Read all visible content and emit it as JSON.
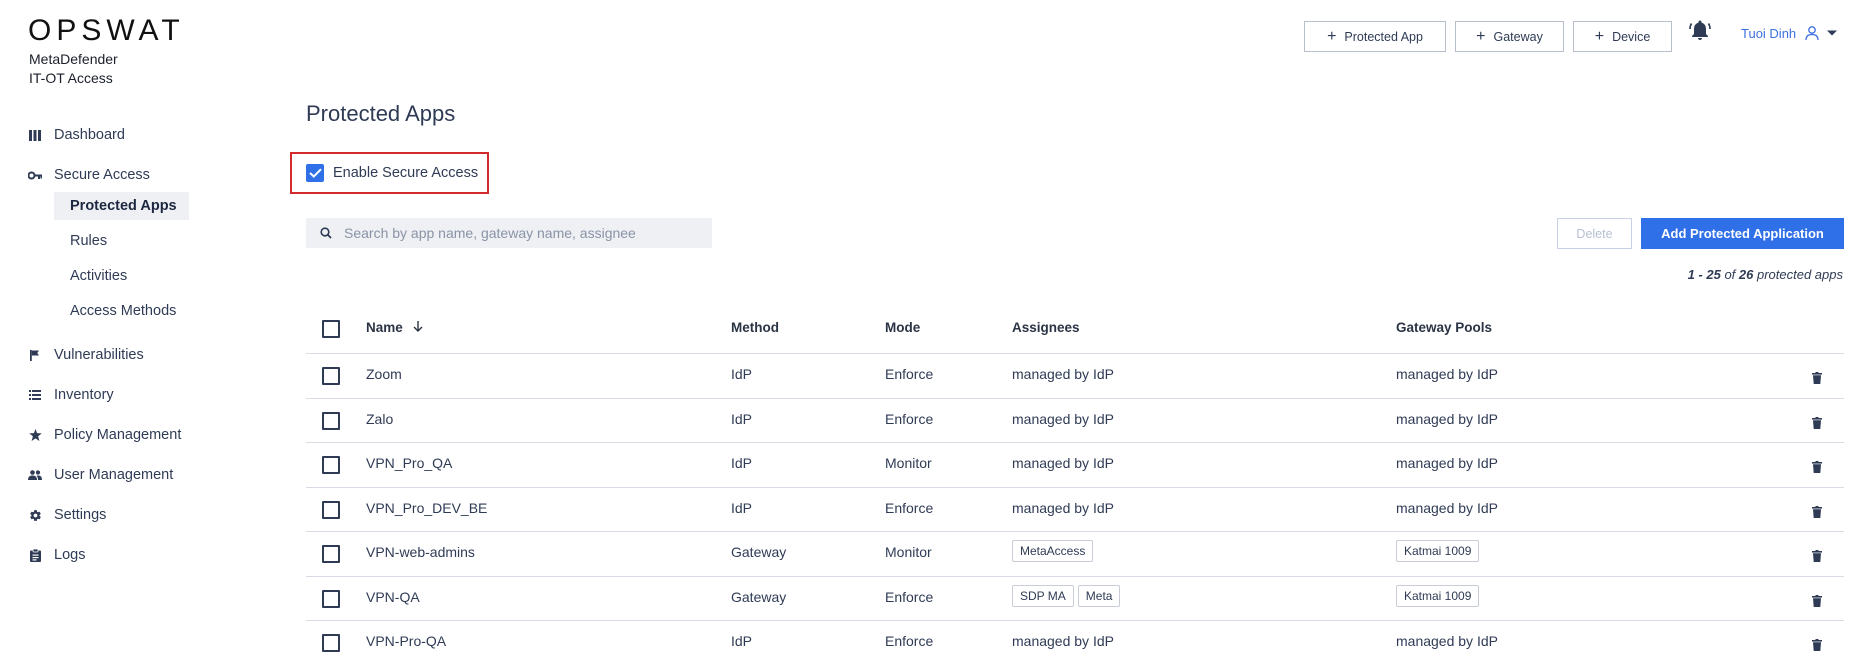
{
  "brand": {
    "logo": "OPSWAT",
    "product_line1": "MetaDefender",
    "product_line2": "IT-OT Access"
  },
  "sidebar": {
    "items": [
      {
        "label": "Dashboard",
        "icon": "dashboard-icon"
      },
      {
        "label": "Secure Access",
        "icon": "key-icon"
      },
      {
        "label": "Vulnerabilities",
        "icon": "flag-icon"
      },
      {
        "label": "Inventory",
        "icon": "list-icon"
      },
      {
        "label": "Policy Management",
        "icon": "star-icon"
      },
      {
        "label": "User Management",
        "icon": "users-icon"
      },
      {
        "label": "Settings",
        "icon": "gear-icon"
      },
      {
        "label": "Logs",
        "icon": "clipboard-icon"
      }
    ],
    "sub_items": [
      {
        "label": "Protected Apps",
        "active": true
      },
      {
        "label": "Rules"
      },
      {
        "label": "Activities"
      },
      {
        "label": "Access Methods"
      }
    ]
  },
  "topbar": {
    "buttons": [
      {
        "label": "Protected App"
      },
      {
        "label": "Gateway"
      },
      {
        "label": "Device"
      }
    ],
    "user_name": "Tuoi Dinh"
  },
  "page": {
    "title": "Protected Apps",
    "enable_label": "Enable Secure Access",
    "search_placeholder": "Search by app name, gateway name, assignee",
    "delete_label": "Delete",
    "add_label": "Add Protected Application",
    "count_prefix": "1 - 25",
    "count_of": " of ",
    "count_total": "26",
    "count_suffix": " protected apps"
  },
  "table": {
    "headers": {
      "name": "Name",
      "method": "Method",
      "mode": "Mode",
      "assignees": "Assignees",
      "gateway_pools": "Gateway Pools"
    },
    "rows": [
      {
        "name": "Zoom",
        "method": "IdP",
        "mode": "Enforce",
        "assignees": [
          "managed by IdP"
        ],
        "assignees_tags": false,
        "pools": [
          "managed by IdP"
        ],
        "pools_tags": false
      },
      {
        "name": "Zalo",
        "method": "IdP",
        "mode": "Enforce",
        "assignees": [
          "managed by IdP"
        ],
        "assignees_tags": false,
        "pools": [
          "managed by IdP"
        ],
        "pools_tags": false
      },
      {
        "name": "VPN_Pro_QA",
        "method": "IdP",
        "mode": "Monitor",
        "assignees": [
          "managed by IdP"
        ],
        "assignees_tags": false,
        "pools": [
          "managed by IdP"
        ],
        "pools_tags": false
      },
      {
        "name": "VPN_Pro_DEV_BE",
        "method": "IdP",
        "mode": "Enforce",
        "assignees": [
          "managed by IdP"
        ],
        "assignees_tags": false,
        "pools": [
          "managed by IdP"
        ],
        "pools_tags": false
      },
      {
        "name": "VPN-web-admins",
        "method": "Gateway",
        "mode": "Monitor",
        "assignees": [
          "MetaAccess"
        ],
        "assignees_tags": true,
        "pools": [
          "Katmai 1009"
        ],
        "pools_tags": true
      },
      {
        "name": "VPN-QA",
        "method": "Gateway",
        "mode": "Enforce",
        "assignees": [
          "SDP MA",
          "Meta"
        ],
        "assignees_tags": true,
        "pools": [
          "Katmai 1009"
        ],
        "pools_tags": true
      },
      {
        "name": "VPN-Pro-QA",
        "method": "IdP",
        "mode": "Enforce",
        "assignees": [
          "managed by IdP"
        ],
        "assignees_tags": false,
        "pools": [
          "managed by IdP"
        ],
        "pools_tags": false
      }
    ]
  },
  "colors": {
    "accent": "#2f6fe8",
    "highlight_border": "#d32a2a",
    "text": "#2f3b55"
  }
}
